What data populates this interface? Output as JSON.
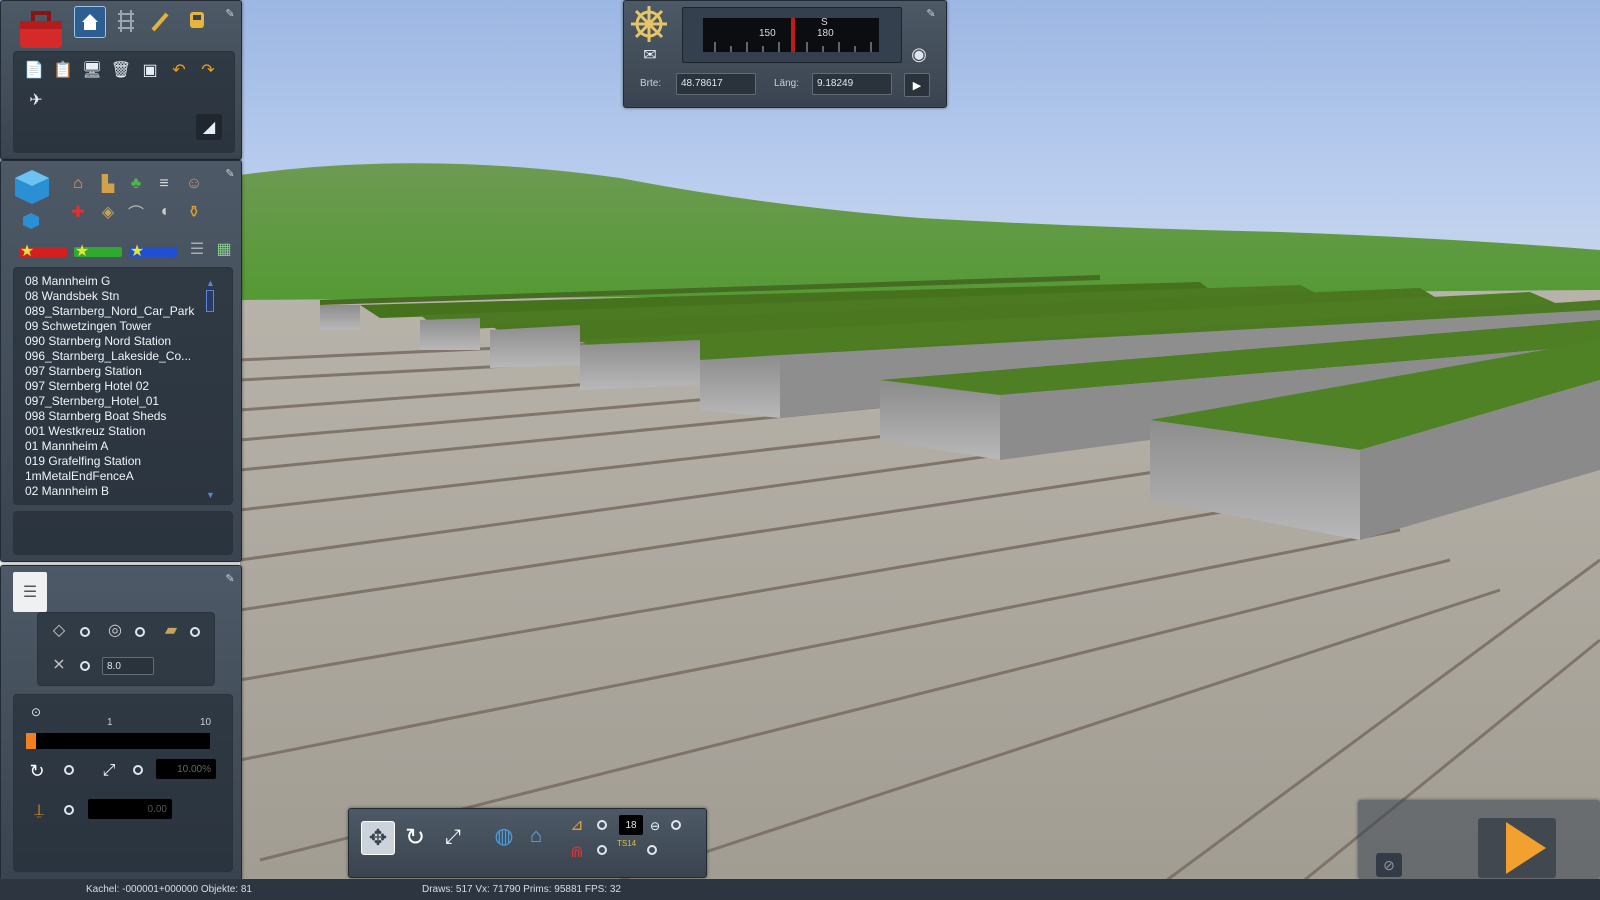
{
  "app": {
    "scene": "3d-rail-yard-viewport"
  },
  "nav": {
    "latitude_label": "Brte:",
    "latitude_value": "48.78617",
    "longitude_label": "Läng:",
    "longitude_value": "9.18249",
    "compass_heading": "S",
    "compass_tick_150": "150",
    "compass_tick_180": "180"
  },
  "asset_filters": {
    "colors": [
      "#d21f1f",
      "#2faa2f",
      "#1f4fd2"
    ]
  },
  "asset_list": [
    "08 Mannheim G",
    "08 Wandsbek Stn",
    "089_Starnberg_Nord_Car_Park",
    "09 Schwetzingen Tower",
    "090 Starnberg Nord Station",
    "096_Starnberg_Lakeside_Co...",
    "097 Starnberg Station",
    "097 Sternberg Hotel 02",
    "097_Sternberg_Hotel_01",
    "098 Starnberg Boat Sheds",
    "001 Westkreuz Station",
    "01 Mannheim A",
    "019 Grafelfing Station",
    "1mMetalEndFenceA",
    "02 Mannheim B"
  ],
  "tools": {
    "height_value": "8.0",
    "scale_min": "1",
    "scale_max": "10",
    "scale_level": 0.02,
    "percent_value": "10.00%",
    "offset_value": "0.00"
  },
  "bottom_toolbar": {
    "layer_value": "18",
    "ts_badge": "TS14"
  },
  "status": {
    "tile_info": "Kachel: -000001+000000  Objekte: 81",
    "perf_info": "Draws: 517 Vx: 71790 Prims: 95881 FPS: 32"
  },
  "icons": {
    "toolbox": "toolbox-icon",
    "home": "home-icon",
    "track": "track-icon",
    "paint": "paint-brush-icon",
    "train": "train-icon",
    "undo": "undo-icon",
    "redo": "redo-icon",
    "compass": "compass-icon",
    "camera": "camera-icon",
    "play": "play-icon"
  }
}
